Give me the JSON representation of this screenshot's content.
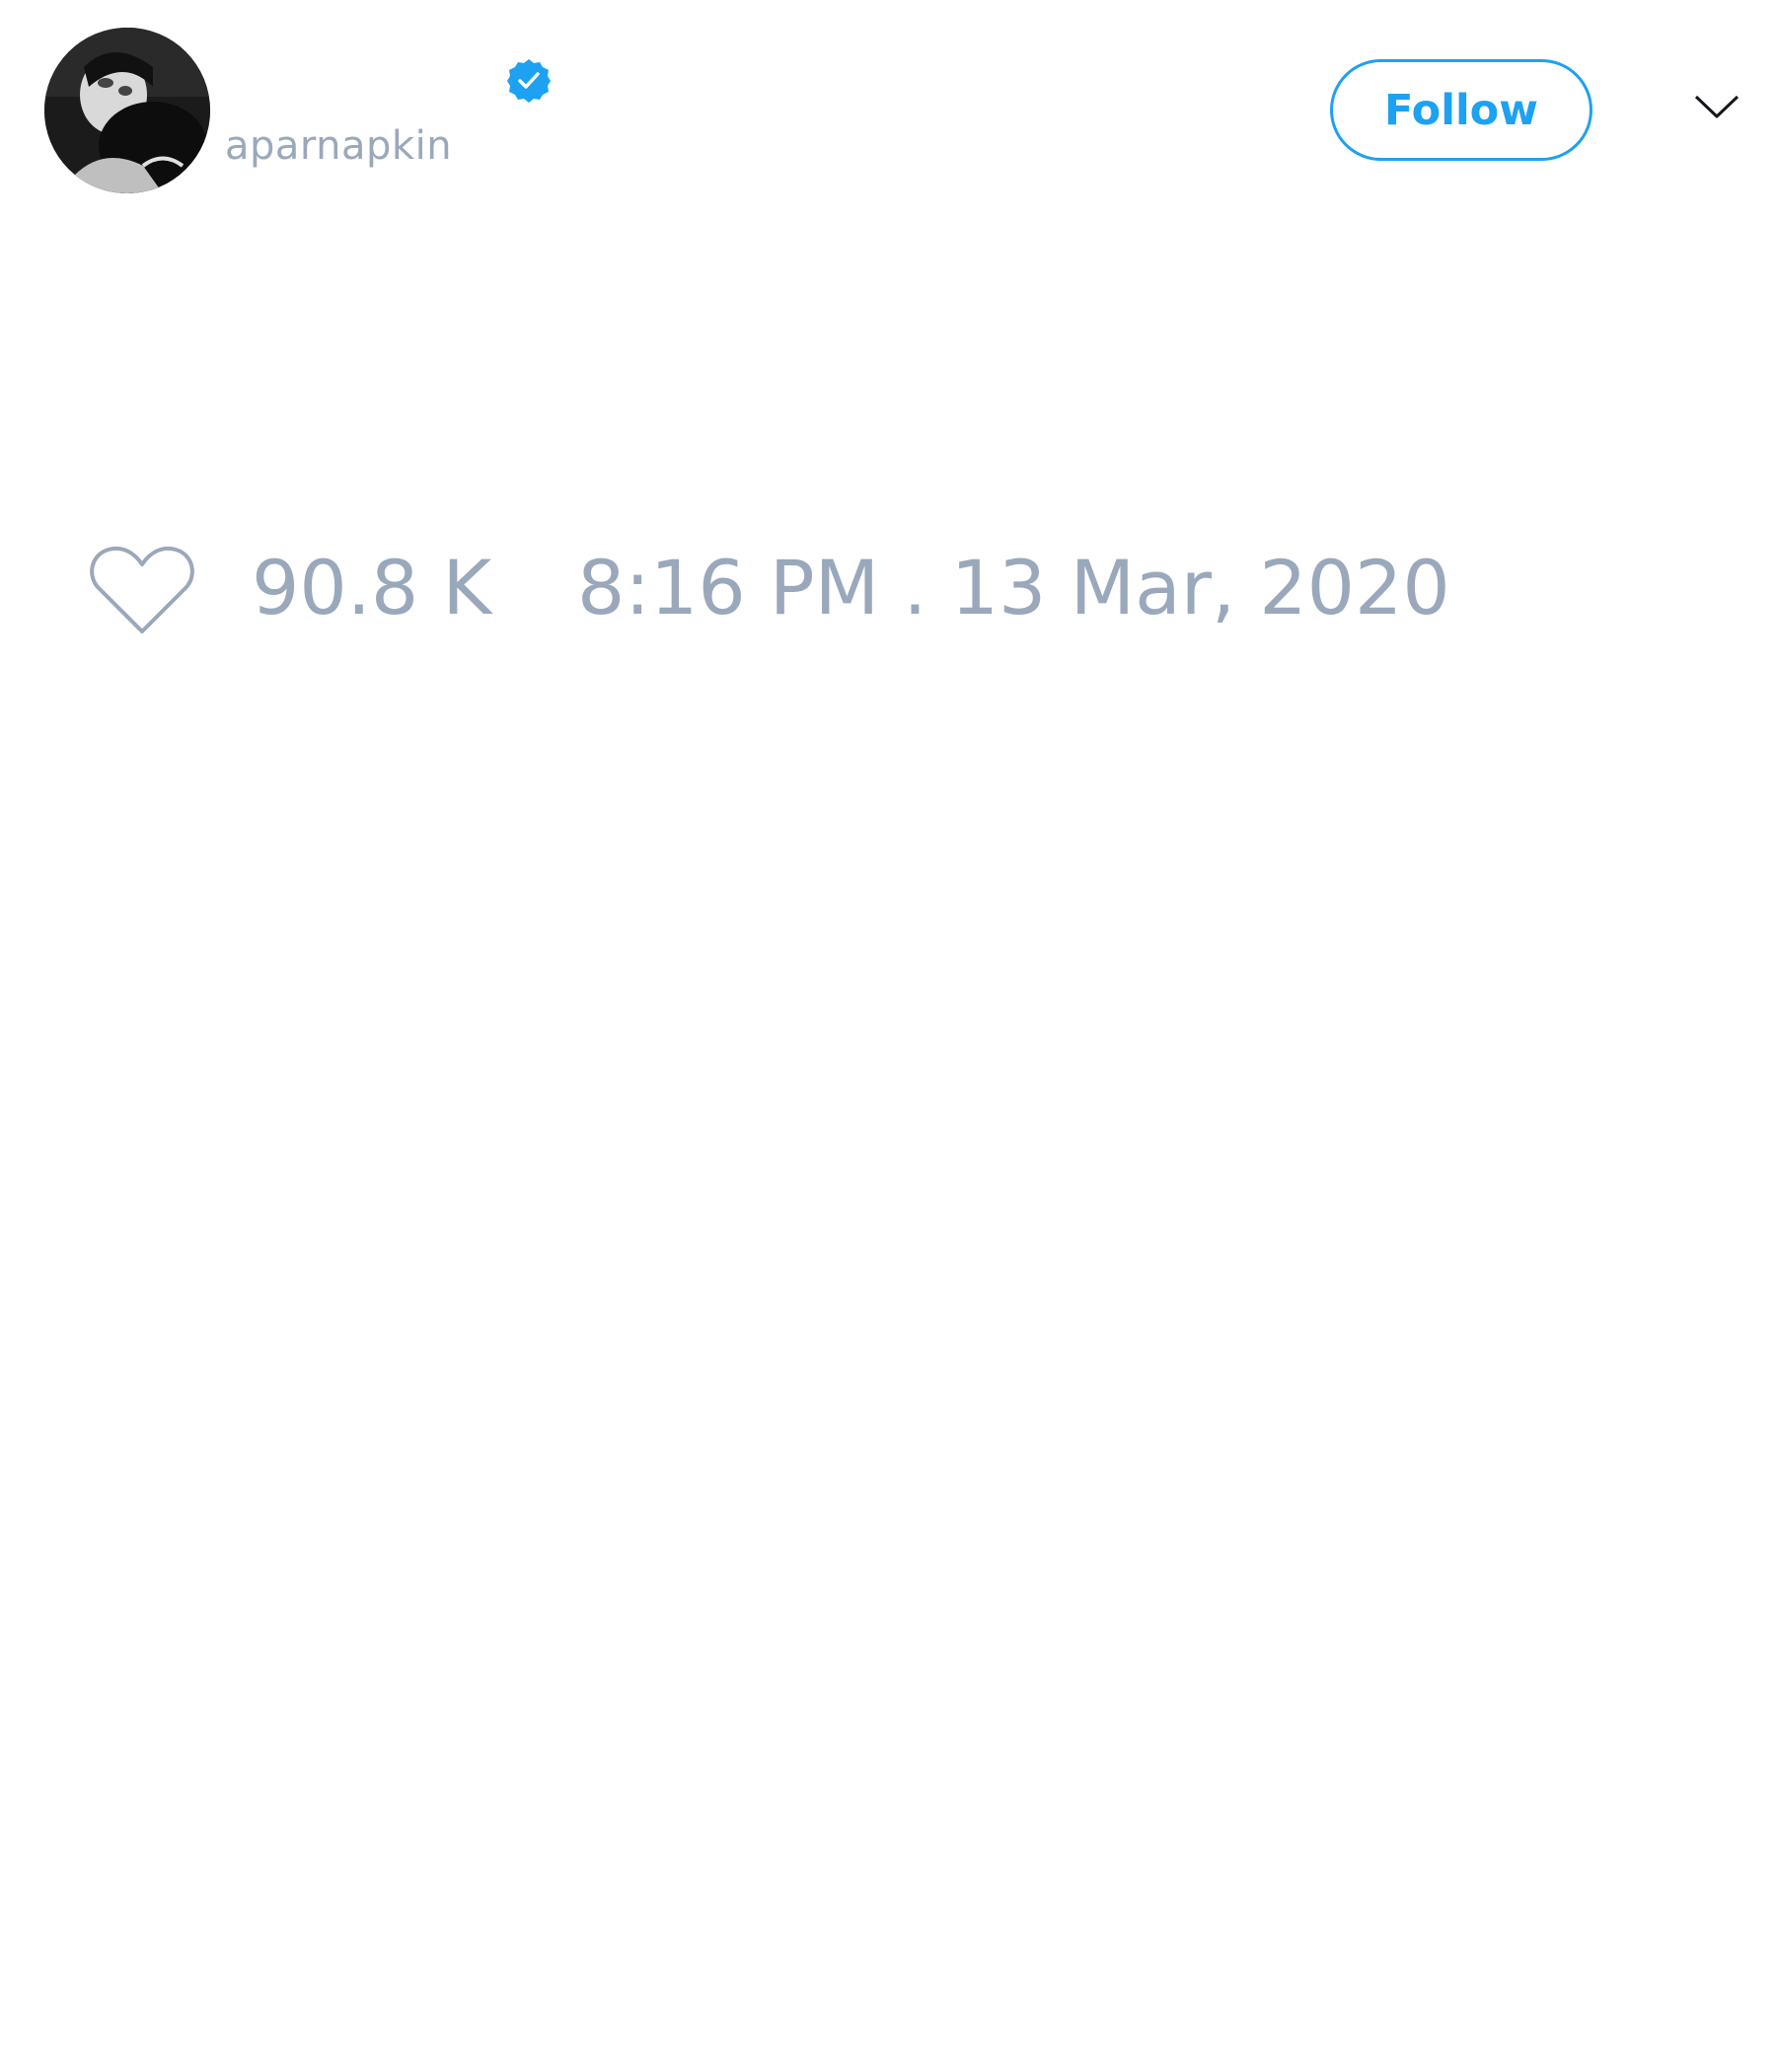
{
  "tweet": {
    "author": {
      "display_name": "",
      "handle": "aparnapkin",
      "verified": true,
      "avatar_icon": "profile-photo"
    },
    "follow_label": "Follow",
    "menu_icon": "chevron-down-icon",
    "like_icon": "heart-icon",
    "like_count": "90.8 K",
    "timestamp": "8:16 PM . 13 Mar, 2020"
  },
  "colors": {
    "accent": "#1da1f2",
    "muted_text": "#9aa8bb",
    "background": "#ffffff"
  }
}
